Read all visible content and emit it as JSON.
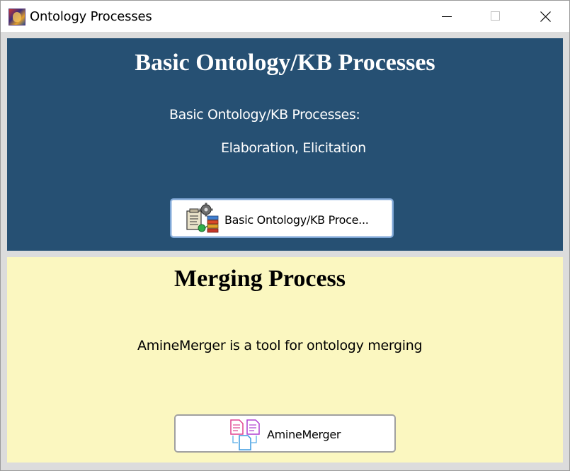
{
  "window": {
    "title": "Ontology Processes",
    "app_icon": "amine-logo-icon",
    "controls": [
      "minimize-icon",
      "maximize-icon",
      "close-icon"
    ]
  },
  "basic_panel": {
    "heading": "Basic Ontology/KB Processes",
    "description_line1": "Basic Ontology/KB Processes:",
    "description_line2": "Elaboration, Elicitation",
    "button_label": "Basic Ontology/KB Proce...",
    "button_icon": "ontology-process-icon",
    "background": "#265073"
  },
  "merging_panel": {
    "heading": "Merging Process",
    "description": "AmineMerger is a tool for ontology merging",
    "button_label": "AmineMerger",
    "button_icon": "merge-documents-icon",
    "background": "#fbf7c0"
  }
}
